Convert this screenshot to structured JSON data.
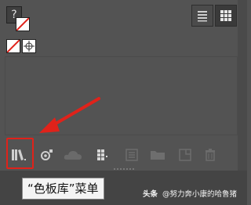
{
  "swatches": {
    "unknown_swatch_glyph": "?",
    "colors": {
      "panel_bg": "#535353",
      "highlight": "#e0221a",
      "none_slash": "#e0221a"
    }
  },
  "view_toggle": {
    "list_view_icon": "list-view-icon",
    "grid_view_icon": "grid-view-icon",
    "selected": "grid"
  },
  "toolbar": {
    "icons": [
      "swatch-libraries-menu-icon",
      "show-kinds-icon",
      "cloud-library-icon",
      "new-color-group-icon",
      "swatch-options-icon",
      "new-folder-icon",
      "new-swatch-icon",
      "delete-swatch-icon"
    ]
  },
  "annotation": {
    "tooltip_text": "“色板库”菜单"
  },
  "watermark": {
    "brand": "头条",
    "author": "@努力奔小康的哈鲁猪"
  }
}
